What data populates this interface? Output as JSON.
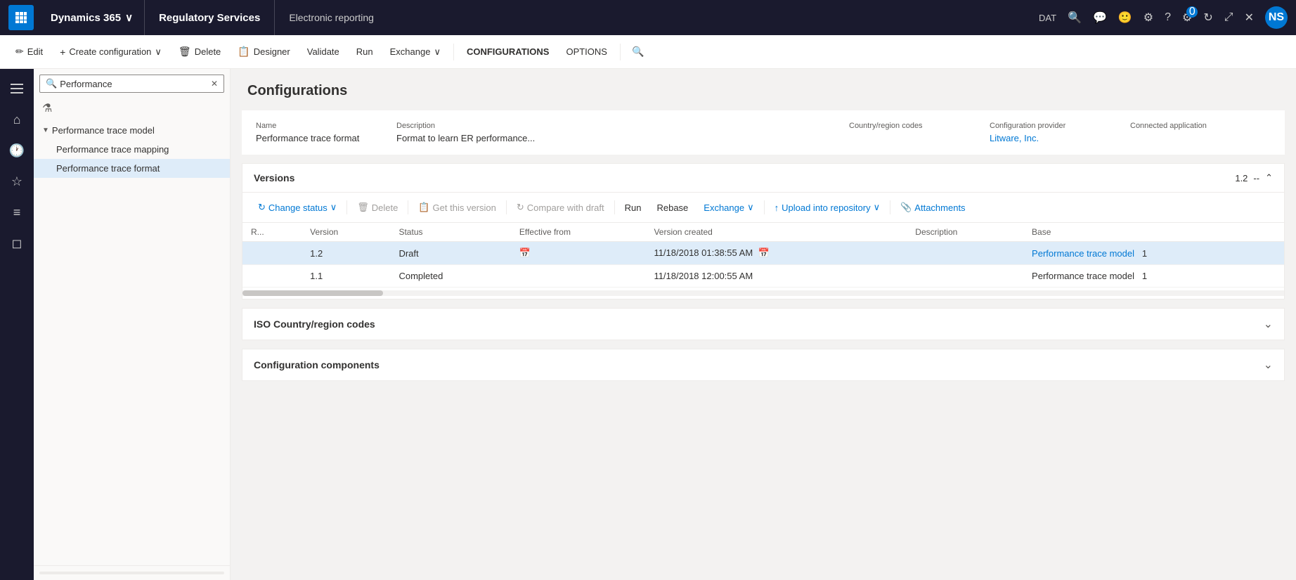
{
  "topbar": {
    "grid_icon": "⊞",
    "dynamics_label": "Dynamics 365",
    "chevron": "⌄",
    "app_name": "Regulatory Services",
    "module": "Electronic reporting",
    "dat_label": "DAT",
    "search_icon": "🔍",
    "message_icon": "💬",
    "face_icon": "🙂",
    "gear_icon": "⚙",
    "help_icon": "?",
    "avatar_initials": "NS",
    "settings_icon": "⚙",
    "apps_icon": "⊞",
    "refresh_icon": "↻",
    "popout_icon": "⤢",
    "close_icon": "✕",
    "notifications_count": "0"
  },
  "toolbar": {
    "edit_label": "Edit",
    "edit_icon": "✏",
    "create_label": "Create configuration",
    "create_icon": "+",
    "delete_label": "Delete",
    "delete_icon": "🗑",
    "designer_label": "Designer",
    "designer_icon": "📋",
    "validate_label": "Validate",
    "run_label": "Run",
    "exchange_label": "Exchange",
    "exchange_icon": "⌄",
    "configurations_label": "CONFIGURATIONS",
    "options_label": "OPTIONS",
    "search_icon": "🔍"
  },
  "sidebar_icons": {
    "home": "⌂",
    "recent": "🕐",
    "bookmark": "☆",
    "list": "≡",
    "box": "◻"
  },
  "left_panel": {
    "search_placeholder": "Performance",
    "search_icon": "🔍",
    "clear_icon": "✕",
    "filter_icon": "⚗",
    "tree": [
      {
        "id": "perf-trace-model",
        "label": "Performance trace model",
        "level": 0,
        "expandable": true,
        "expanded": true,
        "selected": false
      },
      {
        "id": "perf-trace-mapping",
        "label": "Performance trace mapping",
        "level": 1,
        "expandable": false,
        "expanded": false,
        "selected": false
      },
      {
        "id": "perf-trace-format",
        "label": "Performance trace format",
        "level": 1,
        "expandable": false,
        "expanded": false,
        "selected": true
      }
    ]
  },
  "content": {
    "title": "Configurations",
    "details": {
      "name_label": "Name",
      "name_value": "Performance trace format",
      "description_label": "Description",
      "description_value": "Format to learn ER performance...",
      "country_label": "Country/region codes",
      "country_value": "",
      "provider_label": "Configuration provider",
      "provider_value": "Litware, Inc.",
      "connected_label": "Connected application",
      "connected_value": ""
    },
    "versions_section": {
      "title": "Versions",
      "version_display": "1.2",
      "separator": "--",
      "collapse_icon": "⌃",
      "toolbar": {
        "change_status_label": "Change status",
        "change_status_icon": "↻",
        "chevron": "⌄",
        "delete_label": "Delete",
        "delete_icon": "🗑",
        "get_version_label": "Get this version",
        "get_version_icon": "📋",
        "compare_label": "Compare with draft",
        "compare_icon": "↻",
        "run_label": "Run",
        "rebase_label": "Rebase",
        "exchange_label": "Exchange",
        "exchange_icon": "⌄",
        "upload_label": "Upload into repository",
        "upload_icon": "↑",
        "upload_chevron": "⌄",
        "attachments_label": "Attachments",
        "attachments_icon": "📎"
      },
      "columns": [
        "R...",
        "Version",
        "Status",
        "Effective from",
        "Version created",
        "Description",
        "Base"
      ],
      "rows": [
        {
          "r": "",
          "version": "1.2",
          "status": "Draft",
          "effective_from": "",
          "has_cal1": true,
          "version_created": "11/18/2018 01:38:55 AM",
          "has_cal2": true,
          "description": "",
          "base": "Performance trace model",
          "base_num": "1",
          "base_is_link": true,
          "selected": true
        },
        {
          "r": "",
          "version": "1.1",
          "status": "Completed",
          "effective_from": "",
          "has_cal1": false,
          "version_created": "11/18/2018 12:00:55 AM",
          "has_cal2": false,
          "description": "",
          "base": "Performance trace model",
          "base_num": "1",
          "base_is_link": false,
          "selected": false
        }
      ]
    },
    "iso_section": {
      "title": "ISO Country/region codes",
      "collapsed": true,
      "chevron": "⌄"
    },
    "components_section": {
      "title": "Configuration components",
      "collapsed": true,
      "chevron": "⌄"
    }
  }
}
